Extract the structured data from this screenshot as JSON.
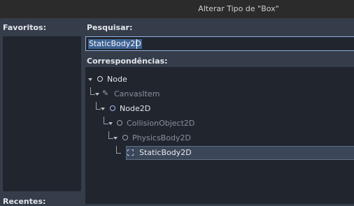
{
  "dialog": {
    "title": "Alterar Tipo de \"Box\""
  },
  "favorites": {
    "label": "Favoritos:"
  },
  "recent": {
    "label": "Recentes:"
  },
  "search": {
    "label": "Pesquisar:",
    "value": "StaticBody2D"
  },
  "matches": {
    "label": "Correspondências:",
    "items": [
      {
        "label": "Node",
        "enabled": true,
        "expanded": true,
        "icon": "node-circle-icon",
        "icon_color": "#e0e0e0"
      },
      {
        "label": "CanvasItem",
        "enabled": false,
        "expanded": true,
        "icon": "canvasitem-pencil-icon",
        "icon_color": "#9da3ab"
      },
      {
        "label": "Node2D",
        "enabled": true,
        "expanded": true,
        "icon": "node2d-circle-icon",
        "icon_color": "#a5b7f3"
      },
      {
        "label": "CollisionObject2D",
        "enabled": false,
        "expanded": true,
        "icon": "collisionobject2d-circle-icon",
        "icon_color": "#9da3ab"
      },
      {
        "label": "PhysicsBody2D",
        "enabled": false,
        "expanded": true,
        "icon": "physicsbody2d-circle-icon",
        "icon_color": "#9da3ab"
      },
      {
        "label": "StaticBody2D",
        "enabled": true,
        "selected": true,
        "icon": "staticbody2d-box-icon",
        "icon_color": "#a5b7f3"
      }
    ]
  },
  "colors": {
    "panel_bg": "#363d4a",
    "field_bg": "#20252e",
    "accent": "#8faee0",
    "selection": "#3e6392"
  }
}
